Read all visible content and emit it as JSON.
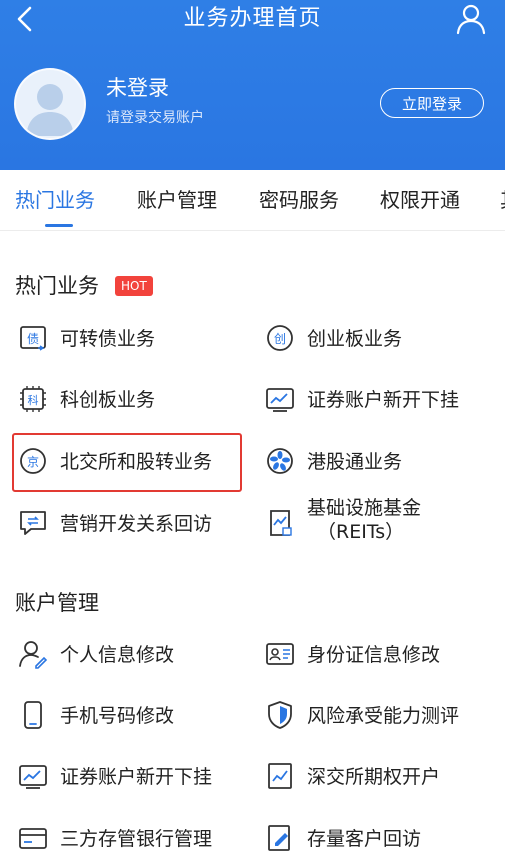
{
  "header": {
    "title": "业务办理首页",
    "user_name": "未登录",
    "user_hint": "请登录交易账户",
    "login_label": "立即登录"
  },
  "tabs": [
    {
      "label": "热门业务",
      "active": true
    },
    {
      "label": "账户管理",
      "active": false
    },
    {
      "label": "密码服务",
      "active": false
    },
    {
      "label": "权限开通",
      "active": false
    },
    {
      "label": "其",
      "active": false
    }
  ],
  "sections": {
    "hot": {
      "title": "热门业务",
      "badge": "HOT",
      "items": [
        {
          "label": "可转债业务",
          "icon": "bond-icon"
        },
        {
          "label": "创业板业务",
          "icon": "chinext-icon"
        },
        {
          "label": "科创板业务",
          "icon": "star-market-icon"
        },
        {
          "label": "证券账户新开下挂",
          "icon": "securities-account-icon"
        },
        {
          "label": "北交所和股转业务",
          "icon": "bse-icon"
        },
        {
          "label": "港股通业务",
          "icon": "hk-connect-icon"
        },
        {
          "label": "营销开发关系回访",
          "icon": "chat-revisit-icon"
        },
        {
          "label_line1": "基础设施基金",
          "label_line2": "（REITs）",
          "icon": "reits-icon"
        }
      ]
    },
    "account": {
      "title": "账户管理",
      "items": [
        {
          "label": "个人信息修改",
          "icon": "person-edit-icon"
        },
        {
          "label": "身份证信息修改",
          "icon": "id-card-icon"
        },
        {
          "label": "手机号码修改",
          "icon": "phone-icon"
        },
        {
          "label": "风险承受能力测评",
          "icon": "shield-icon"
        },
        {
          "label": "证券账户新开下挂",
          "icon": "securities-account-icon"
        },
        {
          "label": "深交所期权开户",
          "icon": "options-icon"
        },
        {
          "label": "三方存管银行管理",
          "icon": "bank-card-icon"
        },
        {
          "label": "存量客户回访",
          "icon": "edit-note-icon"
        }
      ]
    }
  },
  "colors": {
    "primary": "#2a76e2",
    "hot": "#f2433c",
    "highlight": "#e23a33"
  }
}
